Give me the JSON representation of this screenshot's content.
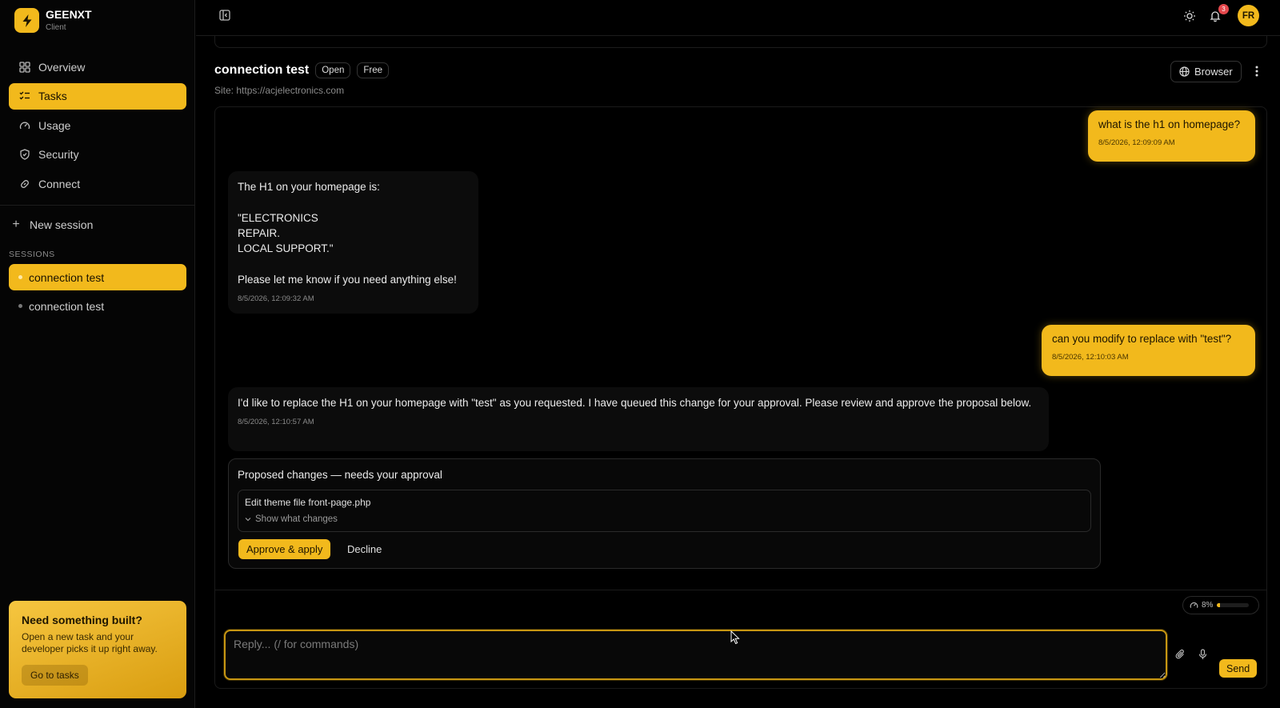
{
  "brand": {
    "name": "GEENXT",
    "subtitle": "Client"
  },
  "nav": [
    {
      "label": "Overview",
      "icon": "grid-icon",
      "active": false
    },
    {
      "label": "Tasks",
      "icon": "checklist-icon",
      "active": true
    },
    {
      "label": "Usage",
      "icon": "gauge-icon",
      "active": false
    },
    {
      "label": "Security",
      "icon": "shield-icon",
      "active": false
    },
    {
      "label": "Connect",
      "icon": "link-icon",
      "active": false
    }
  ],
  "new_session_label": "New session",
  "sessions_label": "SESSIONS",
  "sessions": [
    {
      "label": "connection test",
      "active": true
    },
    {
      "label": "connection test",
      "active": false
    }
  ],
  "promo": {
    "title": "Need something built?",
    "text": "Open a new task and your developer picks it up right away.",
    "button": "Go to tasks"
  },
  "topbar": {
    "notification_count": "3",
    "avatar_initials": "FR"
  },
  "task": {
    "title": "connection test",
    "status": "Open",
    "plan": "Free",
    "site": "Site: https://acjelectronics.com",
    "browser_label": "Browser"
  },
  "messages": [
    {
      "role": "user",
      "text": "what is the h1 on homepage?",
      "time": "8/5/2026, 12:09:09 AM"
    },
    {
      "role": "assistant",
      "text": "The H1 on your homepage is:\n\n\"ELECTRONICS\nREPAIR.\nLOCAL SUPPORT.\"\n\nPlease let me know if you need anything else!",
      "time": "8/5/2026, 12:09:32 AM"
    },
    {
      "role": "user",
      "text": "can you modify to replace with \"test\"?",
      "time": "8/5/2026, 12:10:03 AM"
    },
    {
      "role": "assistant",
      "text": "I'd like to replace the H1 on your homepage with \"test\" as you requested. I have queued this change for your approval. Please review and approve the proposal below.",
      "time": "8/5/2026, 12:10:57 AM"
    }
  ],
  "proposal": {
    "title": "Proposed changes — needs your approval",
    "change": "Edit theme file front-page.php",
    "show_changes": "Show what changes",
    "approve": "Approve & apply",
    "decline": "Decline"
  },
  "usage": {
    "percent_label": "8%",
    "fraction": 0.08
  },
  "reply": {
    "placeholder": "Reply... (/ for commands)",
    "send": "Send"
  },
  "colors": {
    "accent": "#f2b91c",
    "background": "#000000",
    "badge": "#e5484d"
  }
}
